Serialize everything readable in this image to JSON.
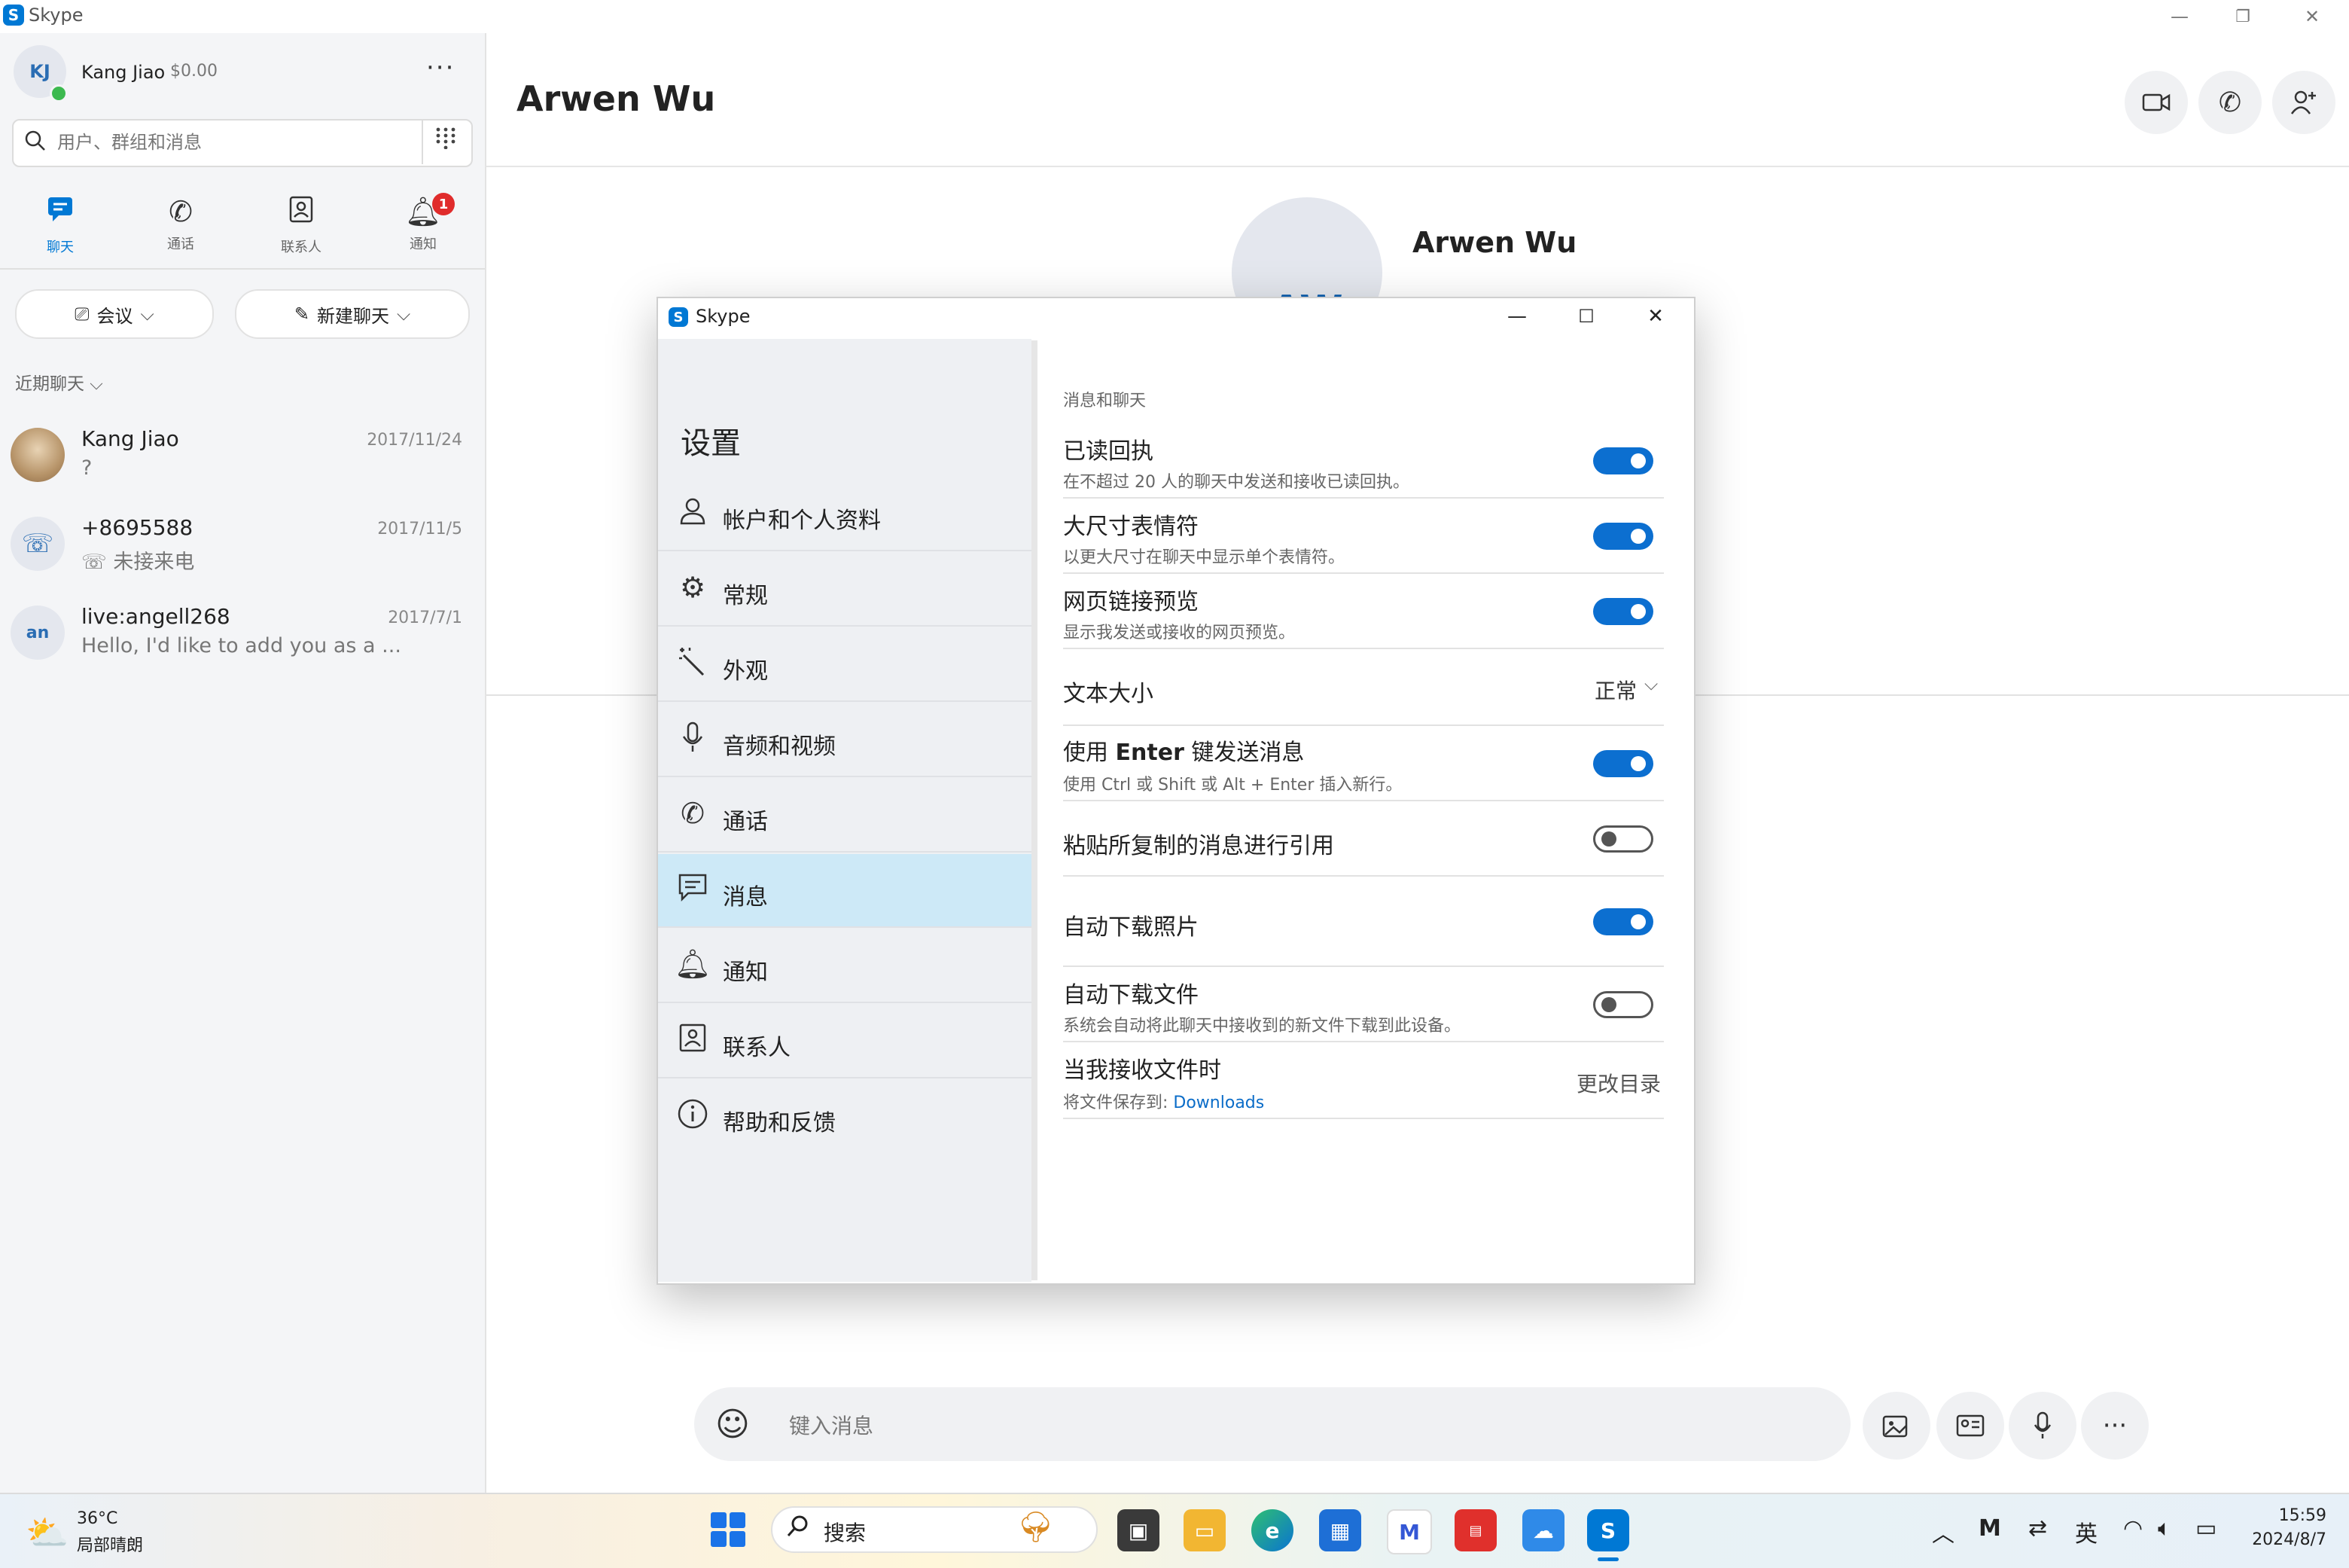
{
  "app": {
    "title": "Skype",
    "logo_letter": "S"
  },
  "window_controls": {
    "minimize": "—",
    "restore": "❐",
    "close": "✕"
  },
  "user": {
    "initials": "KJ",
    "name": "Kang Jiao",
    "balance": "$0.00",
    "more": "···"
  },
  "search": {
    "placeholder": "用户、群组和消息"
  },
  "nav_tabs": [
    {
      "label": "聊天",
      "icon": "chat-icon"
    },
    {
      "label": "通话",
      "icon": "phone-icon"
    },
    {
      "label": "联系人",
      "icon": "contacts-icon"
    },
    {
      "label": "通知",
      "icon": "bell-icon",
      "badge": "1"
    }
  ],
  "actions": {
    "meeting": "会议",
    "new_chat": "新建聊天"
  },
  "recent_header": "近期聊天",
  "chats": [
    {
      "name": "Kang Jiao",
      "date": "2017/11/24",
      "preview": "?",
      "avatar": ""
    },
    {
      "name": "+8695588",
      "date": "2017/11/5",
      "preview": "未接来电",
      "avatar": "☏"
    },
    {
      "name": "live:angell268",
      "date": "2017/7/1",
      "preview": "Hello, I'd like to add you as a ...",
      "avatar": "an"
    }
  ],
  "conversation": {
    "title": "Arwen Wu",
    "avatar_initials": "AW",
    "profile_name": "Arwen Wu"
  },
  "composer": {
    "placeholder": "键入消息"
  },
  "settings": {
    "window_title": "Skype",
    "heading": "设置",
    "nav": [
      {
        "label": "帐户和个人资料",
        "icon": "person-icon"
      },
      {
        "label": "常规",
        "icon": "gear-icon"
      },
      {
        "label": "外观",
        "icon": "magic-wand-icon"
      },
      {
        "label": "音频和视频",
        "icon": "microphone-icon"
      },
      {
        "label": "通话",
        "icon": "phone-icon"
      },
      {
        "label": "消息",
        "icon": "message-icon",
        "active": true
      },
      {
        "label": "通知",
        "icon": "bell-icon"
      },
      {
        "label": "联系人",
        "icon": "contacts-icon"
      },
      {
        "label": "帮助和反馈",
        "icon": "info-icon"
      }
    ],
    "section_title": "消息和聊天",
    "options": {
      "read_receipts": {
        "title": "已读回执",
        "desc": "在不超过 20 人的聊天中发送和接收已读回执。",
        "enabled": true
      },
      "large_emoticons": {
        "title": "大尺寸表情符",
        "desc": "以更大尺寸在聊天中显示单个表情符。",
        "enabled": true
      },
      "link_preview": {
        "title": "网页链接预览",
        "desc": "显示我发送或接收的网页预览。",
        "enabled": true
      },
      "text_size": {
        "title": "文本大小",
        "value": "正常"
      },
      "enter_to_send": {
        "title_pre": "使用 ",
        "title_key": "Enter",
        "title_post": " 键发送消息",
        "desc": "使用 Ctrl 或 Shift 或 Alt + Enter 插入新行。",
        "enabled": true
      },
      "paste_quote": {
        "title": "粘贴所复制的消息进行引用",
        "enabled": false
      },
      "auto_download_photos": {
        "title": "自动下载照片",
        "enabled": true
      },
      "auto_download_files": {
        "title": "自动下载文件",
        "desc": "系统会自动将此聊天中接收到的新文件下载到此设备。",
        "enabled": false
      },
      "file_location": {
        "title": "当我接收文件时",
        "desc_prefix": "将文件保存到: ",
        "link": "Downloads",
        "action": "更改目录"
      }
    }
  },
  "taskbar": {
    "weather_temp": "36°C",
    "weather_desc": "局部晴朗",
    "search_label": "搜索",
    "ime": "英",
    "time": "15:59",
    "date": "2024/8/7"
  },
  "colors": {
    "accent": "#0078d4",
    "toggle_on": "#0c6fd0",
    "badge": "#e02c2c",
    "nav_active": "#cde9f7"
  }
}
